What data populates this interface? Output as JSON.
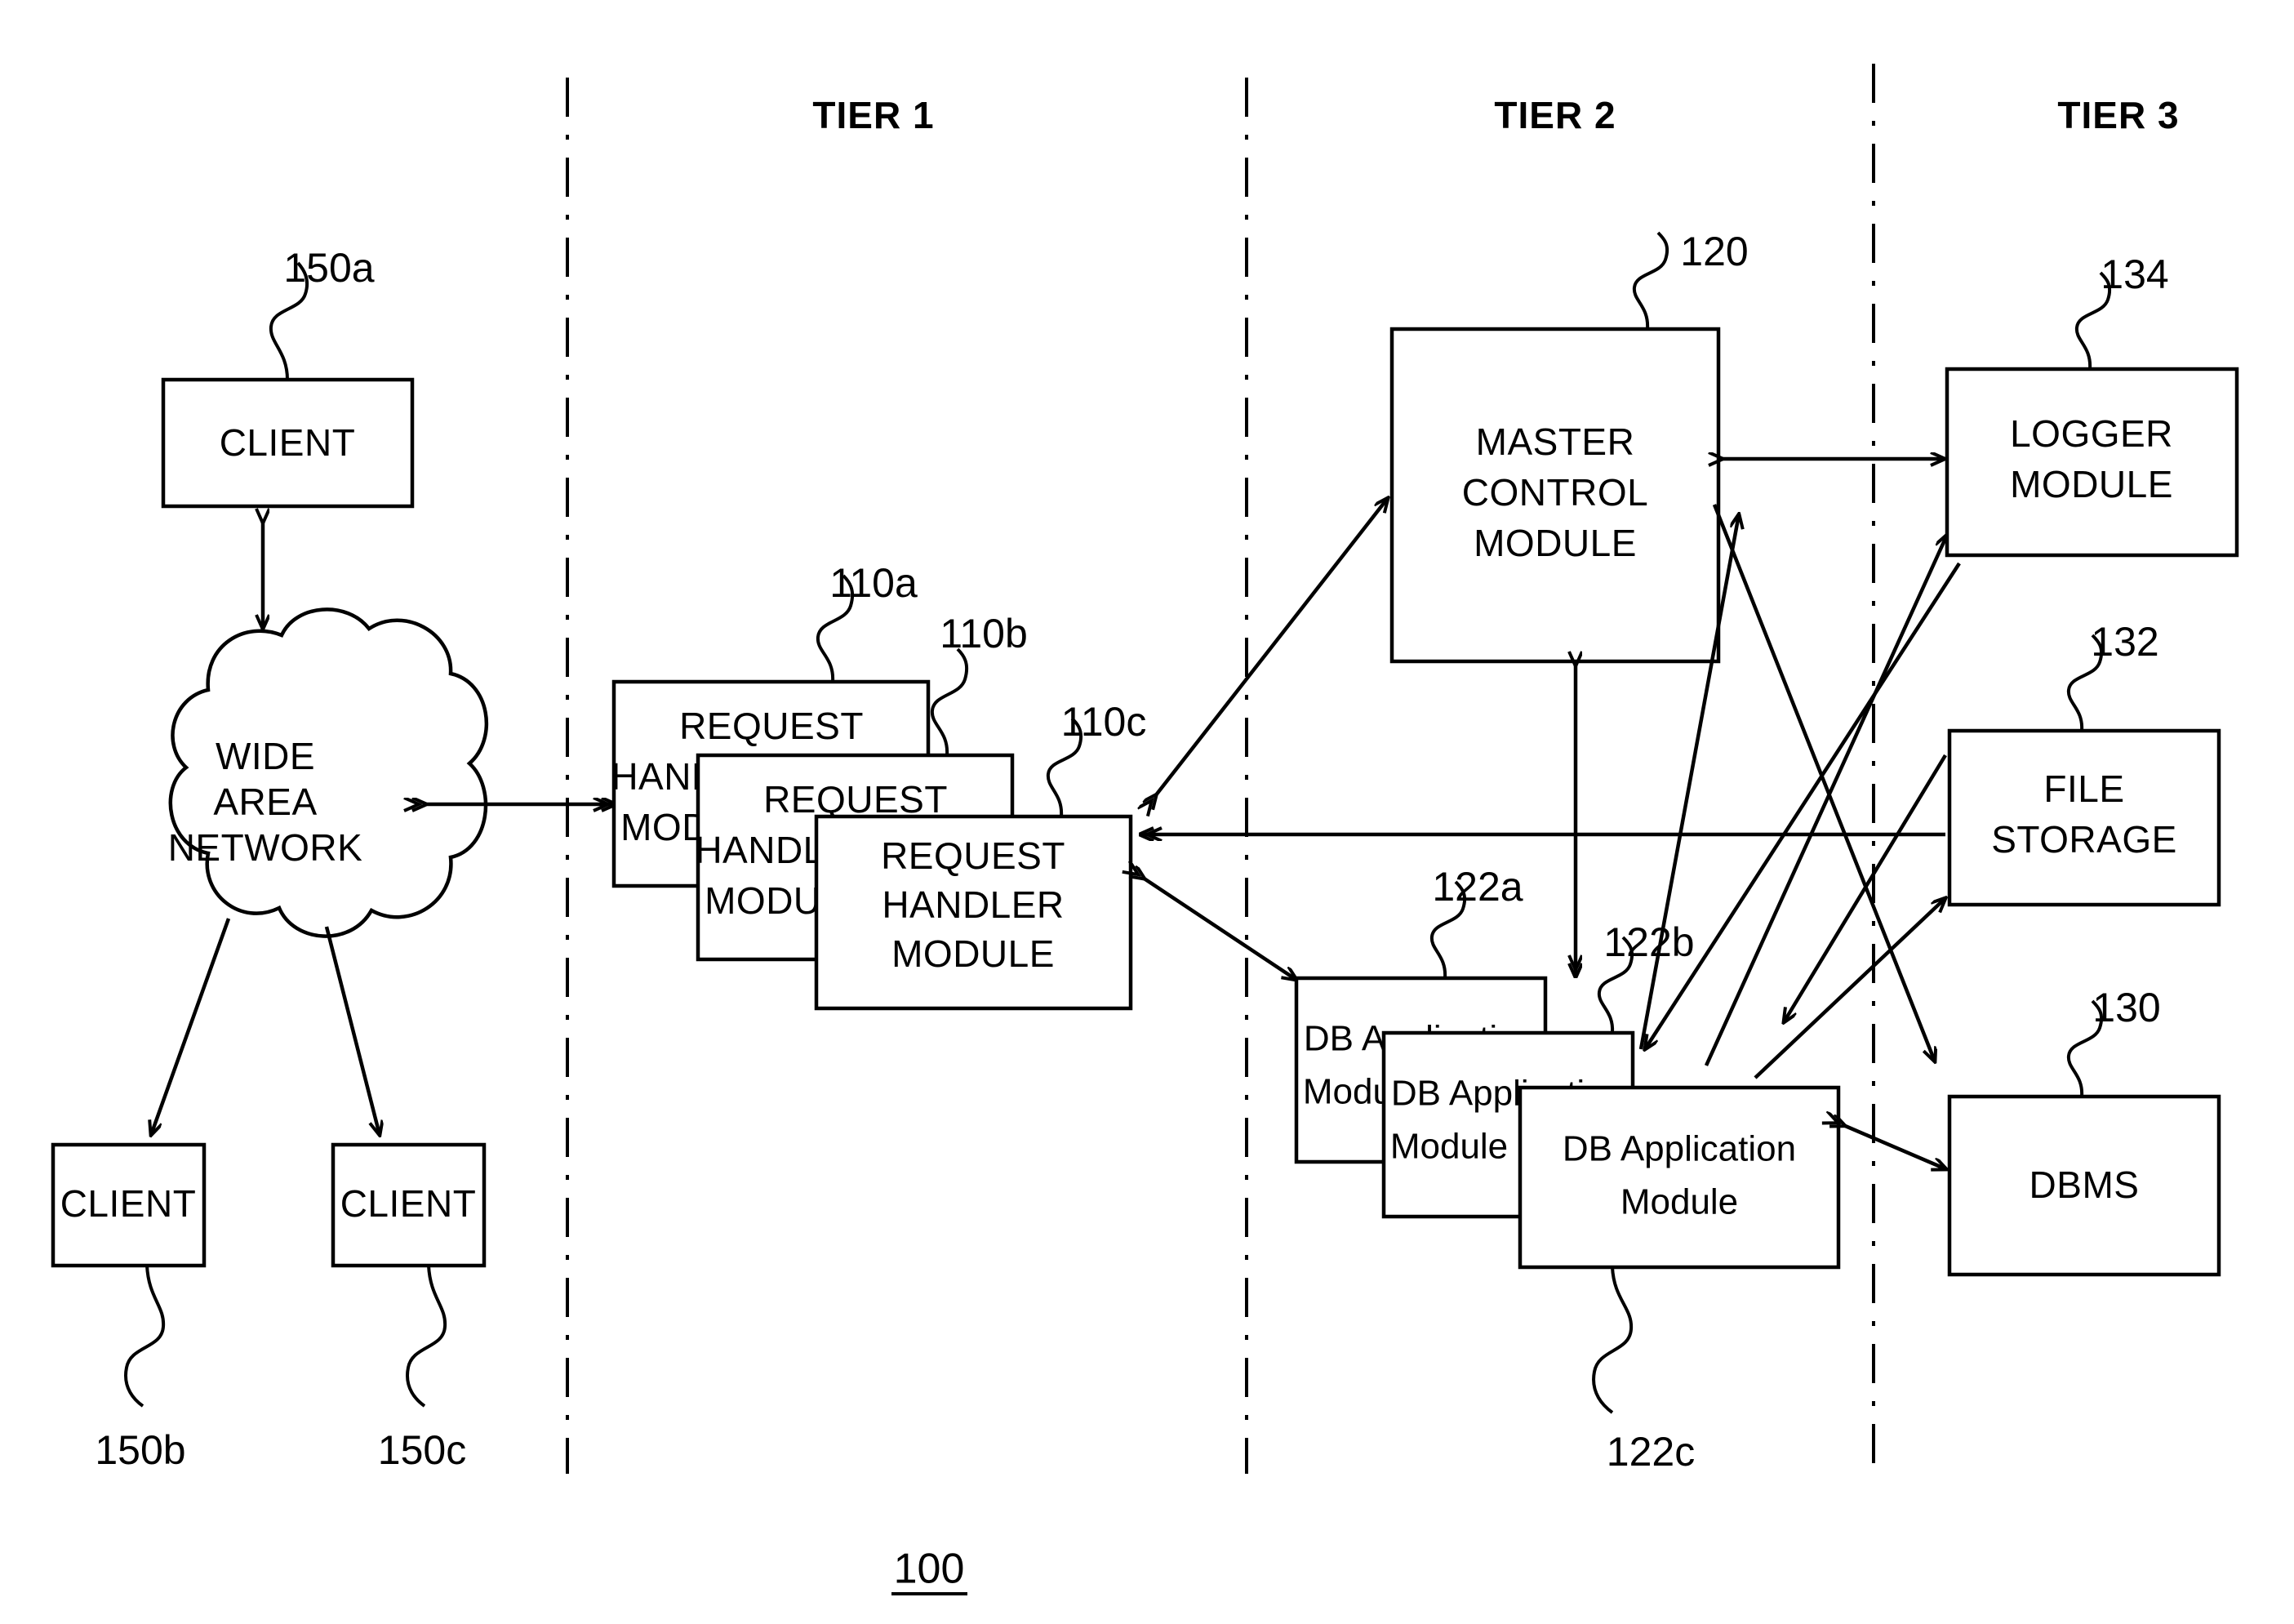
{
  "figure": {
    "number": "100",
    "tiers": [
      {
        "id": "tier1",
        "label": "TIER 1"
      },
      {
        "id": "tier2",
        "label": "TIER 2"
      },
      {
        "id": "tier3",
        "label": "TIER 3"
      }
    ]
  },
  "nodes": {
    "client_a": {
      "label": "CLIENT",
      "ref": "150a"
    },
    "client_b": {
      "label": "CLIENT",
      "ref": "150b"
    },
    "client_c": {
      "label": "CLIENT",
      "ref": "150c"
    },
    "wan": {
      "line1": "WIDE",
      "line2": "AREA",
      "line3": "NETWORK"
    },
    "request_handler_a": {
      "line1": "REQUEST",
      "line2": "HANDLER",
      "line3": "MODULE",
      "ref": "110a"
    },
    "request_handler_b": {
      "line1": "REQUEST",
      "line2": "HANDLER",
      "line3": "MODULE",
      "ref": "110b"
    },
    "request_handler_c": {
      "line1": "REQUEST",
      "line2": "HANDLER",
      "line3": "MODULE",
      "ref": "110c"
    },
    "master_control": {
      "line1": "MASTER",
      "line2": "CONTROL",
      "line3": "MODULE",
      "ref": "120"
    },
    "db_app_a": {
      "line1": "DB Application",
      "line2": "Module",
      "ref": "122a"
    },
    "db_app_b": {
      "line1": "DB Application",
      "line2": "Module",
      "ref": "122b"
    },
    "db_app_c": {
      "line1": "DB Application",
      "line2": "Module",
      "ref": "122c"
    },
    "logger": {
      "line1": "LOGGER",
      "line2": "MODULE",
      "ref": "134"
    },
    "file_storage": {
      "line1": "FILE",
      "line2": "STORAGE",
      "ref": "132"
    },
    "dbms": {
      "line1": "DBMS",
      "ref": "130"
    }
  },
  "colors": {
    "ink": "#000000",
    "paper": "#ffffff"
  }
}
